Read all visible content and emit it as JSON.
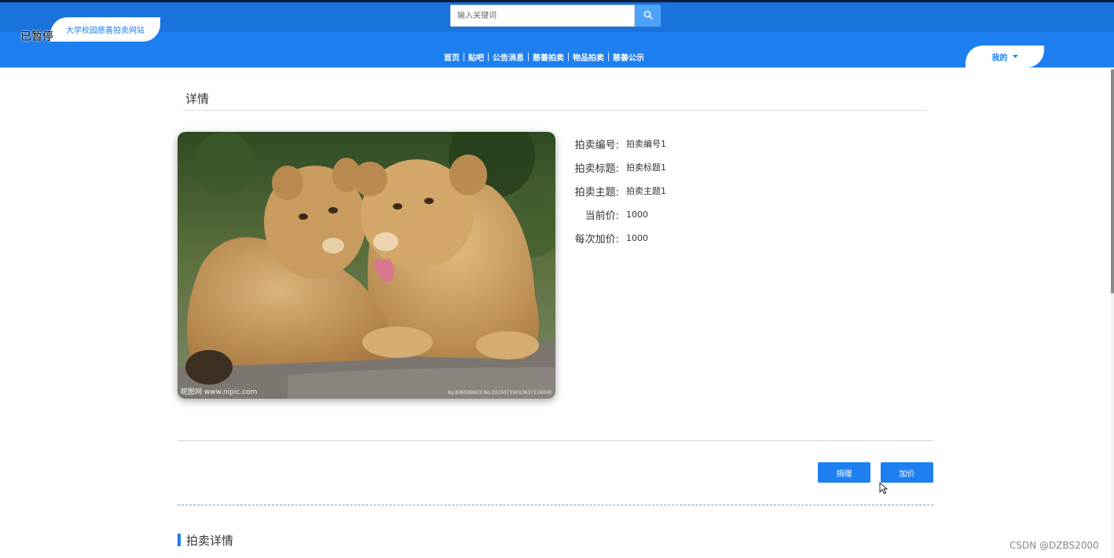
{
  "overlay": {
    "paused_label": "已暂停"
  },
  "header": {
    "site_name": "大学校园慈善拍卖网站",
    "search": {
      "placeholder": "输入关键词"
    },
    "nav": [
      "首页",
      "贴吧",
      "公告消息",
      "慈善拍卖",
      "物品拍卖",
      "慈善公示"
    ],
    "user_menu": "我的",
    "icons": {
      "search": "search-icon",
      "user_menu": "caret-down-icon"
    }
  },
  "detail": {
    "section_title": "详情",
    "image": {
      "subject": "two lion cubs",
      "watermark_left": "昵图网 www.nipic.com",
      "watermark_right": "By:836599603 No:20150719013637116000"
    },
    "fields": [
      {
        "label": "拍卖编号:",
        "value": "拍卖编号1"
      },
      {
        "label": "拍卖标题:",
        "value": "拍卖标题1"
      },
      {
        "label": "拍卖主题:",
        "value": "拍卖主题1"
      },
      {
        "label": "当前价:",
        "value": "1000"
      },
      {
        "label": "每次加价:",
        "value": "1000"
      }
    ]
  },
  "actions": {
    "donate": "捐赠",
    "raise_bid": "加价"
  },
  "subsection": {
    "title": "拍卖详情"
  },
  "watermark": "CSDN @DZBS2000",
  "colors": {
    "primary": "#1e7ff0",
    "header_strip": "#1a72dc",
    "text": "#333333"
  }
}
